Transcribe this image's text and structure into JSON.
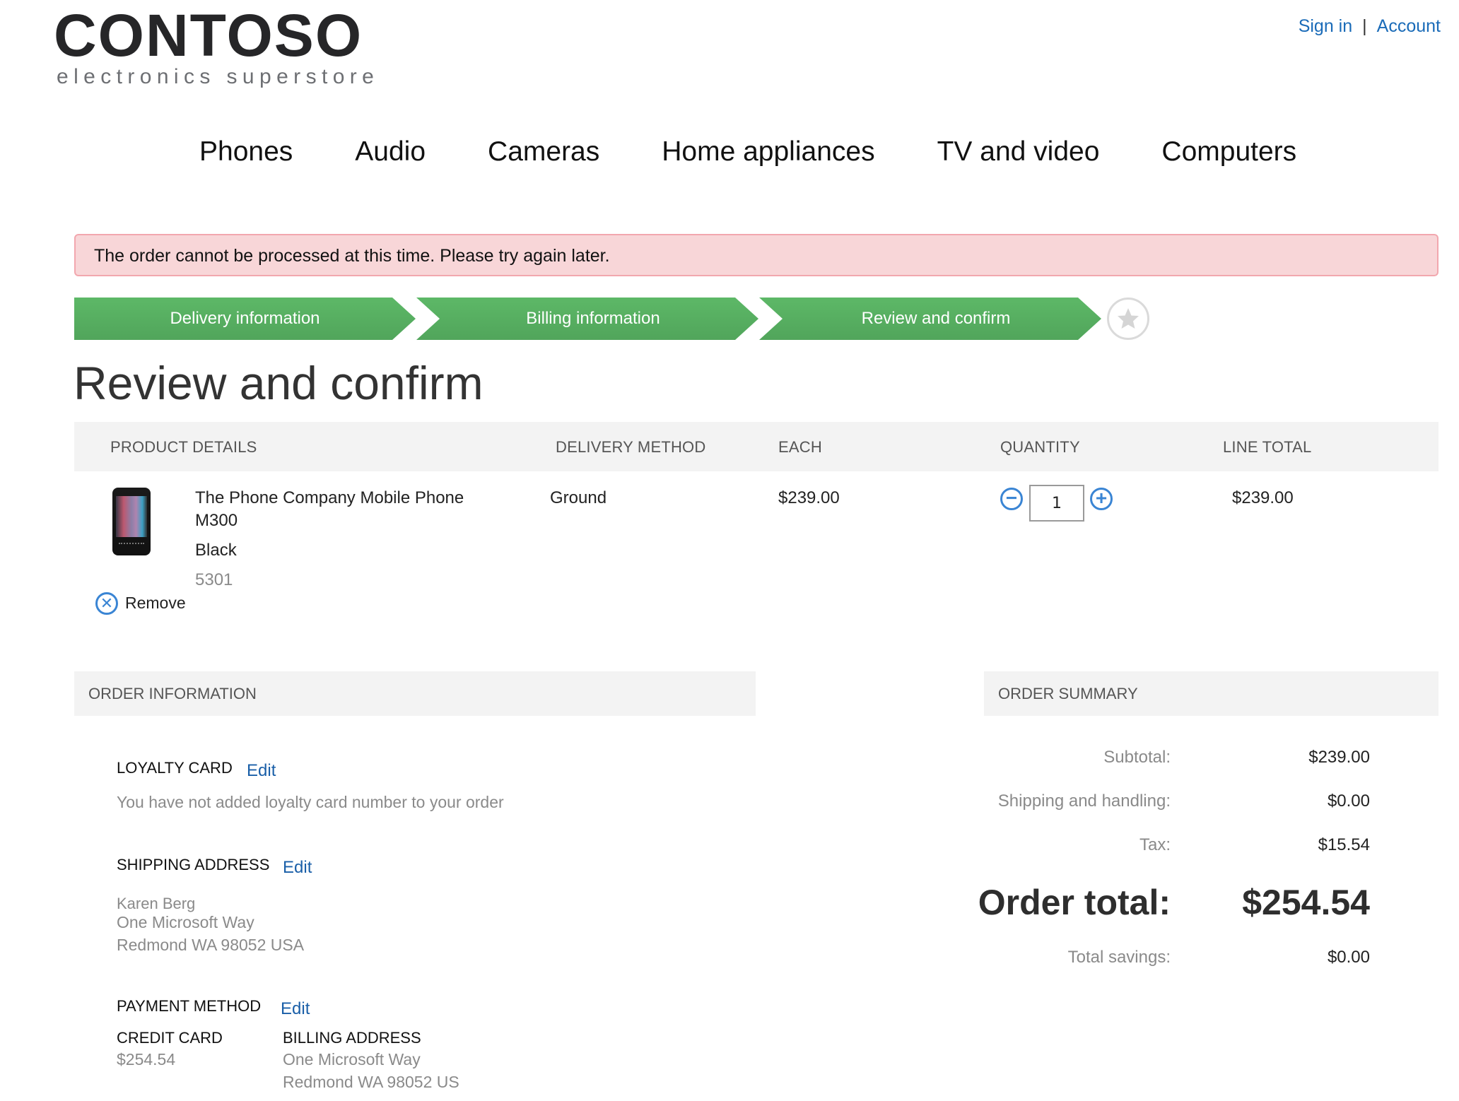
{
  "brand": {
    "name": "CONTOSO",
    "tagline": "electronics superstore"
  },
  "header": {
    "sign_in": "Sign in",
    "separator": "|",
    "account": "Account"
  },
  "nav": {
    "items": [
      {
        "label": "Phones"
      },
      {
        "label": "Audio"
      },
      {
        "label": "Cameras"
      },
      {
        "label": "Home appliances"
      },
      {
        "label": "TV and video"
      },
      {
        "label": "Computers"
      }
    ]
  },
  "alert": {
    "message": "The order cannot be processed at this time. Please try again later.",
    "background": "#f8d6d8",
    "border": "#f2a7ae"
  },
  "checkout_steps": {
    "steps": [
      {
        "label": "Delivery information",
        "status": "complete"
      },
      {
        "label": "Billing information",
        "status": "complete"
      },
      {
        "label": "Review and confirm",
        "status": "current"
      }
    ],
    "final_icon": "star-icon",
    "accent": "#58b063"
  },
  "page": {
    "title": "Review and confirm"
  },
  "cart": {
    "columns": [
      "PRODUCT DETAILS",
      "DELIVERY METHOD",
      "EACH",
      "QUANTITY",
      "LINE TOTAL"
    ],
    "items": [
      {
        "name_line1": "The Phone Company Mobile Phone",
        "name_line2": "M300",
        "color": "Black",
        "sku": "5301",
        "remove_label": "Remove",
        "delivery_method": "Ground",
        "each": "$239.00",
        "quantity": "1",
        "line_total": "$239.00"
      }
    ]
  },
  "order_information": {
    "title": "ORDER INFORMATION",
    "loyalty": {
      "label": "LOYALTY CARD",
      "edit": "Edit",
      "text": "You have not added loyalty card number to your order"
    },
    "shipping": {
      "label": "SHIPPING ADDRESS",
      "edit": "Edit",
      "name": "Karen Berg",
      "line1": "One Microsoft Way",
      "line2": "Redmond WA 98052 USA"
    },
    "payment": {
      "label": "PAYMENT METHOD",
      "edit": "Edit",
      "card_label": "CREDIT CARD",
      "card_amount": "$254.54",
      "billing_label": "BILLING ADDRESS",
      "billing_line1": "One Microsoft Way",
      "billing_line2": "Redmond WA 98052 US"
    }
  },
  "order_summary": {
    "title": "ORDER SUMMARY",
    "subtotal_label": "Subtotal:",
    "subtotal": "$239.00",
    "shipping_label": "Shipping and handling:",
    "shipping": "$0.00",
    "tax_label": "Tax:",
    "tax": "$15.54",
    "total_label": "Order total:",
    "total": "$254.54",
    "savings_label": "Total savings:",
    "savings": "$0.00"
  }
}
